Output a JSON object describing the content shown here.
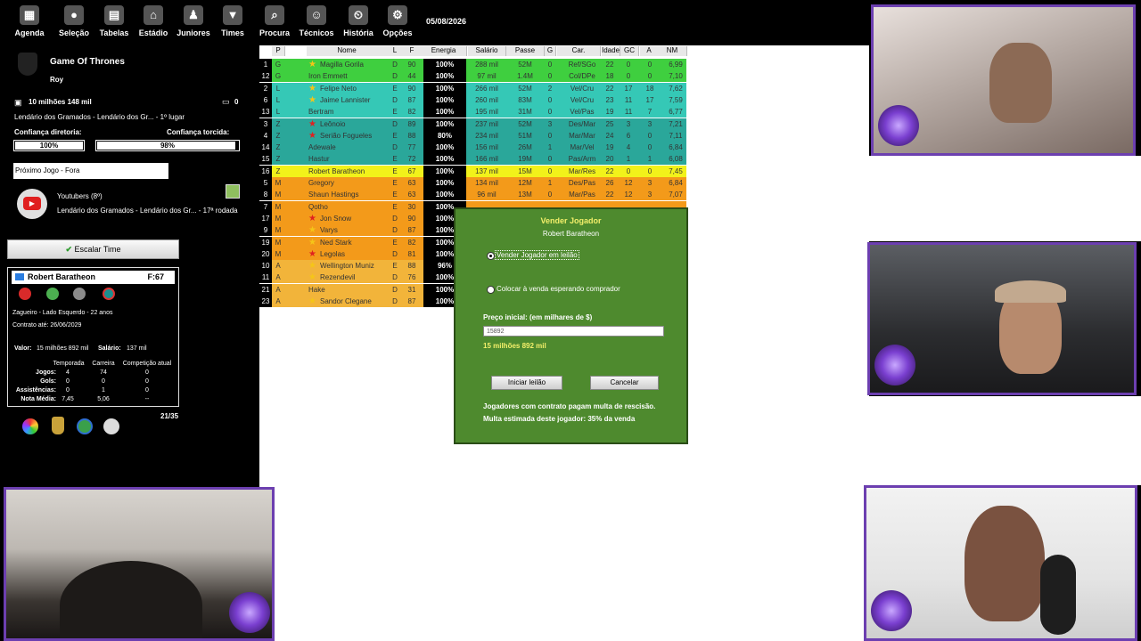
{
  "nav": {
    "items": [
      {
        "label": "Agenda",
        "icon": "calendar-icon",
        "glyph": "▦"
      },
      {
        "label": "Seleção",
        "icon": "flag-ball-icon",
        "glyph": "●"
      },
      {
        "label": "Tabelas",
        "icon": "table-icon",
        "glyph": "▤"
      },
      {
        "label": "Estádio",
        "icon": "stadium-icon",
        "glyph": "⌂"
      },
      {
        "label": "Juniores",
        "icon": "junior-player-icon",
        "glyph": "♟"
      },
      {
        "label": "Times",
        "icon": "shirt-icon",
        "glyph": "▼"
      },
      {
        "label": "Procura",
        "icon": "search-icon",
        "glyph": "⌕"
      },
      {
        "label": "Técnicos",
        "icon": "coach-icon",
        "glyph": "☺"
      },
      {
        "label": "História",
        "icon": "history-icon",
        "glyph": "⏲"
      },
      {
        "label": "Opções",
        "icon": "options-icon",
        "glyph": "⚙"
      }
    ],
    "date": "05/08/2026"
  },
  "club": {
    "name": "Game Of Thrones",
    "manager": "Roy",
    "money": "10 milhões 148 mil",
    "messages": "0",
    "league": "Lendário dos Gramados - Lendário dos Gr... - 1º lugar",
    "board_label": "Confiança diretoria:",
    "board_value": "100%",
    "board_fraction": 1.0,
    "fans_label": "Confiança torcida:",
    "fans_value": "98%",
    "fans_fraction": 0.98,
    "next_game": "Próximo Jogo - Fora",
    "opponent": "Youtubers (8º)",
    "competition": "Lendário dos Gramados - Lendário dos Gr... - 17ª rodada",
    "escalar_label": "Escalar Time",
    "progress": "21/35"
  },
  "card": {
    "name": "Robert Baratheon",
    "force": "F:67",
    "position": "Zagueiro - Lado Esquerdo - 22 anos",
    "contract": "Contrato até: 26/06/2029",
    "value_label": "Valor:",
    "value": "15 milhões 892 mil",
    "salary_label": "Salário:",
    "salary": "137 mil",
    "cols": [
      "Temporada",
      "Carreira",
      "Competição atual"
    ],
    "rows": [
      {
        "label": "Jogos:",
        "v": [
          "4",
          "74",
          "0"
        ]
      },
      {
        "label": "Gols:",
        "v": [
          "0",
          "0",
          "0"
        ]
      },
      {
        "label": "Assistências:",
        "v": [
          "0",
          "1",
          "0"
        ]
      },
      {
        "label": "Nota Média:",
        "v": [
          "7,45",
          "5,06",
          "--"
        ]
      }
    ]
  },
  "squad": {
    "headers": [
      "P",
      "Nome",
      "L",
      "F",
      "Energia",
      "Salário",
      "Passe",
      "G",
      "Car.",
      "Idade",
      "GC",
      "A",
      "NM"
    ],
    "rows": [
      {
        "n": "1",
        "p": "G",
        "name": "Magilla Gorila",
        "l": "D",
        "f": "90",
        "e": "100%",
        "sal": "288 mil",
        "passe": "52M",
        "g": "0",
        "car": "Ref/SGo",
        "idade": "22",
        "gc": "0",
        "a": "0",
        "nm": "6,99",
        "color": "#3fcf3f",
        "star": "gold"
      },
      {
        "n": "12",
        "p": "G",
        "name": "Iron Emmett",
        "l": "D",
        "f": "44",
        "e": "100%",
        "sal": "97 mil",
        "passe": "1.4M",
        "g": "0",
        "car": "Col/DPe",
        "idade": "18",
        "gc": "0",
        "a": "0",
        "nm": "7,10",
        "color": "#3fcf3f",
        "star": ""
      },
      {
        "n": "2",
        "p": "L",
        "name": "Felipe Neto",
        "l": "E",
        "f": "90",
        "e": "100%",
        "sal": "266 mil",
        "passe": "52M",
        "g": "2",
        "car": "Vel/Cru",
        "idade": "22",
        "gc": "17",
        "a": "18",
        "nm": "7,62",
        "color": "#35c8b6",
        "star": "gold"
      },
      {
        "n": "6",
        "p": "L",
        "name": "Jaime Lannister",
        "l": "D",
        "f": "87",
        "e": "100%",
        "sal": "260 mil",
        "passe": "83M",
        "g": "0",
        "car": "Vel/Cru",
        "idade": "23",
        "gc": "11",
        "a": "17",
        "nm": "7,59",
        "color": "#35c8b6",
        "star": "gold"
      },
      {
        "n": "13",
        "p": "L",
        "name": "Bertram",
        "l": "E",
        "f": "82",
        "e": "100%",
        "sal": "195 mil",
        "passe": "31M",
        "g": "0",
        "car": "Vel/Pas",
        "idade": "19",
        "gc": "11",
        "a": "7",
        "nm": "6,77",
        "color": "#35c8b6",
        "star": ""
      },
      {
        "n": "3",
        "p": "Z",
        "name": "Leônoio",
        "l": "D",
        "f": "89",
        "e": "100%",
        "sal": "237 mil",
        "passe": "52M",
        "g": "3",
        "car": "Des/Mar",
        "idade": "25",
        "gc": "3",
        "a": "3",
        "nm": "7,21",
        "color": "#2aa79a",
        "star": "red"
      },
      {
        "n": "4",
        "p": "Z",
        "name": "Serião Fogueles",
        "l": "E",
        "f": "88",
        "e": "80%",
        "sal": "234 mil",
        "passe": "51M",
        "g": "0",
        "car": "Mar/Mar",
        "idade": "24",
        "gc": "6",
        "a": "0",
        "nm": "7,11",
        "color": "#2aa79a",
        "star": "red"
      },
      {
        "n": "14",
        "p": "Z",
        "name": "Adewale",
        "l": "D",
        "f": "77",
        "e": "100%",
        "sal": "156 mil",
        "passe": "26M",
        "g": "1",
        "car": "Mar/Vel",
        "idade": "19",
        "gc": "4",
        "a": "0",
        "nm": "6,84",
        "color": "#2aa79a",
        "star": ""
      },
      {
        "n": "15",
        "p": "Z",
        "name": "Hastur",
        "l": "E",
        "f": "72",
        "e": "100%",
        "sal": "166 mil",
        "passe": "19M",
        "g": "0",
        "car": "Pas/Arm",
        "idade": "20",
        "gc": "1",
        "a": "1",
        "nm": "6,08",
        "color": "#2aa79a",
        "star": ""
      },
      {
        "n": "16",
        "p": "Z",
        "name": "Robert Baratheon",
        "l": "E",
        "f": "67",
        "e": "100%",
        "sal": "137 mil",
        "passe": "15M",
        "g": "0",
        "car": "Mar/Res",
        "idade": "22",
        "gc": "0",
        "a": "0",
        "nm": "7,45",
        "color": "#f2f21a",
        "star": ""
      },
      {
        "n": "5",
        "p": "M",
        "name": "Gregory",
        "l": "E",
        "f": "63",
        "e": "100%",
        "sal": "134 mil",
        "passe": "12M",
        "g": "1",
        "car": "Des/Pas",
        "idade": "26",
        "gc": "12",
        "a": "3",
        "nm": "6,84",
        "color": "#f39a1a",
        "star": ""
      },
      {
        "n": "8",
        "p": "M",
        "name": "Shaun Hastings",
        "l": "E",
        "f": "63",
        "e": "100%",
        "sal": "96 mil",
        "passe": "13M",
        "g": "0",
        "car": "Mar/Pas",
        "idade": "22",
        "gc": "12",
        "a": "3",
        "nm": "7,07",
        "color": "#f39a1a",
        "star": ""
      },
      {
        "n": "7",
        "p": "M",
        "name": "Qotho",
        "l": "E",
        "f": "30",
        "e": "100%",
        "sal": "",
        "passe": "",
        "g": "",
        "car": "",
        "idade": "",
        "gc": "",
        "a": "",
        "nm": "",
        "color": "#f39a1a",
        "star": ""
      },
      {
        "n": "17",
        "p": "M",
        "name": "Jon Snow",
        "l": "D",
        "f": "90",
        "e": "100%",
        "sal": "",
        "passe": "",
        "g": "",
        "car": "",
        "idade": "",
        "gc": "",
        "a": "",
        "nm": "",
        "color": "#f39a1a",
        "star": "red"
      },
      {
        "n": "9",
        "p": "M",
        "name": "Varys",
        "l": "D",
        "f": "87",
        "e": "100%",
        "sal": "",
        "passe": "",
        "g": "",
        "car": "",
        "idade": "",
        "gc": "",
        "a": "",
        "nm": "",
        "color": "#f39a1a",
        "star": "gold"
      },
      {
        "n": "19",
        "p": "M",
        "name": "Ned Stark",
        "l": "E",
        "f": "82",
        "e": "100%",
        "sal": "",
        "passe": "",
        "g": "",
        "car": "",
        "idade": "",
        "gc": "",
        "a": "",
        "nm": "",
        "color": "#f39a1a",
        "star": "gold"
      },
      {
        "n": "20",
        "p": "M",
        "name": "Legolas",
        "l": "D",
        "f": "81",
        "e": "100%",
        "sal": "",
        "passe": "",
        "g": "",
        "car": "",
        "idade": "",
        "gc": "",
        "a": "",
        "nm": "",
        "color": "#f39a1a",
        "star": "red"
      },
      {
        "n": "10",
        "p": "A",
        "name": "Wellington Muniz",
        "l": "E",
        "f": "88",
        "e": "96%",
        "sal": "",
        "passe": "",
        "g": "",
        "car": "",
        "idade": "",
        "gc": "",
        "a": "",
        "nm": "",
        "color": "#f2b43a",
        "star": "gold"
      },
      {
        "n": "11",
        "p": "A",
        "name": "Rezendevil",
        "l": "D",
        "f": "76",
        "e": "100%",
        "sal": "",
        "passe": "",
        "g": "",
        "car": "",
        "idade": "",
        "gc": "",
        "a": "",
        "nm": "",
        "color": "#f2b43a",
        "star": "gold"
      },
      {
        "n": "21",
        "p": "A",
        "name": "Hake",
        "l": "D",
        "f": "31",
        "e": "100%",
        "sal": "",
        "passe": "",
        "g": "",
        "car": "",
        "idade": "",
        "gc": "",
        "a": "",
        "nm": "",
        "color": "#f2b43a",
        "star": ""
      },
      {
        "n": "23",
        "p": "A",
        "name": "Sandor Clegane",
        "l": "D",
        "f": "87",
        "e": "100%",
        "sal": "",
        "passe": "",
        "g": "",
        "car": "",
        "idade": "",
        "gc": "",
        "a": "",
        "nm": "",
        "color": "#f2b43a",
        "star": "gold"
      }
    ]
  },
  "dialog": {
    "title": "Vender Jogador",
    "player": "Robert Baratheon",
    "option1": "Vender Jogador em leilão",
    "option2": "Colocar à venda esperando comprador",
    "price_label": "Preço inicial: (em milhares de $)",
    "price_value": "15892",
    "price_text": "15 milhões 892 mil",
    "start_button": "Iniciar leilão",
    "cancel_button": "Cancelar",
    "note1": "Jogadores com contrato pagam multa de rescisão.",
    "note2": "Multa estimada deste jogador: 35% da venda"
  }
}
